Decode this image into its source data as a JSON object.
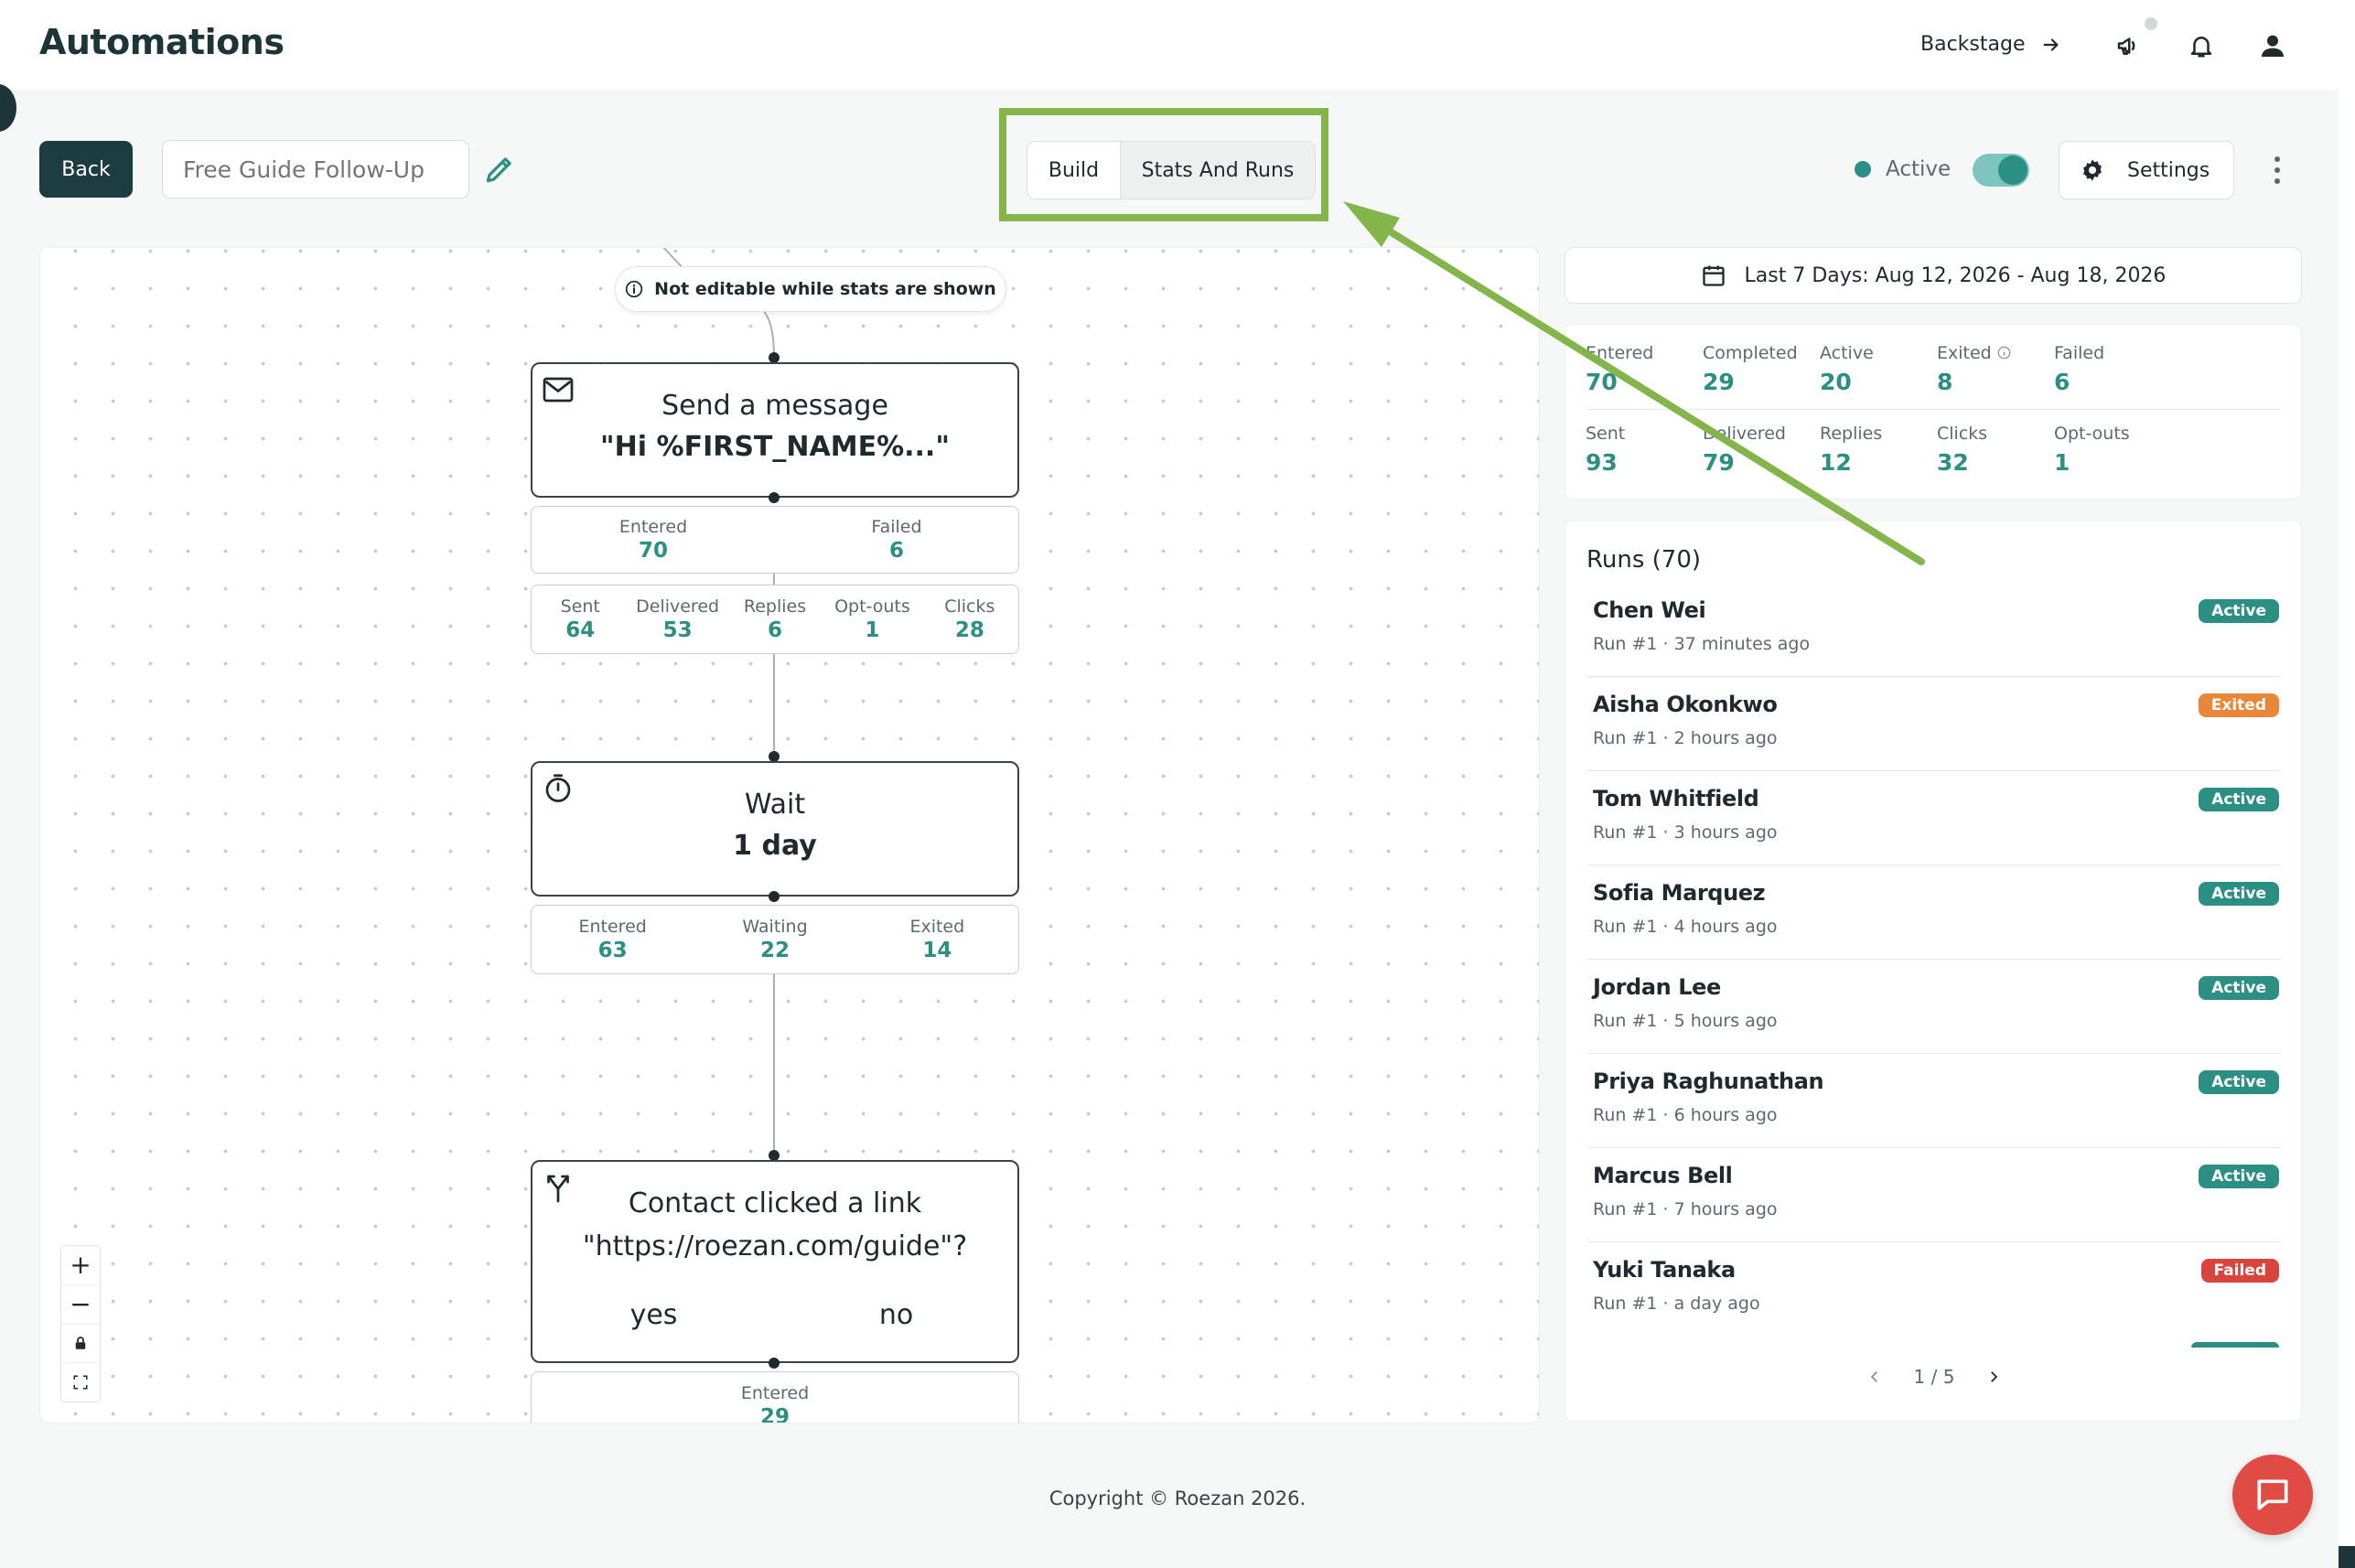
{
  "header": {
    "title": "Automations",
    "backstage_label": "Backstage"
  },
  "toolbar": {
    "back_label": "Back",
    "name_placeholder": "Free Guide Follow-Up",
    "tabs": [
      {
        "label": "Build",
        "selected": false
      },
      {
        "label": "Stats And Runs",
        "selected": true
      }
    ],
    "status_label": "Active",
    "status_on": true,
    "settings_label": "Settings"
  },
  "canvas": {
    "notice": "Not editable while stats are shown",
    "nodes": {
      "send": {
        "title": "Send a message",
        "subtitle": "\"Hi %FIRST_NAME%...\"",
        "stats_top": [
          {
            "label": "Entered",
            "value": "70"
          },
          {
            "label": "Failed",
            "value": "6"
          }
        ],
        "stats_bottom": [
          {
            "label": "Sent",
            "value": "64"
          },
          {
            "label": "Delivered",
            "value": "53"
          },
          {
            "label": "Replies",
            "value": "6"
          },
          {
            "label": "Opt-outs",
            "value": "1"
          },
          {
            "label": "Clicks",
            "value": "28"
          }
        ]
      },
      "wait": {
        "title": "Wait",
        "subtitle": "1 day",
        "stats": [
          {
            "label": "Entered",
            "value": "63"
          },
          {
            "label": "Waiting",
            "value": "22"
          },
          {
            "label": "Exited",
            "value": "14"
          }
        ]
      },
      "condition": {
        "title": "Contact clicked a link",
        "subtitle": "\"https://roezan.com/guide\"?",
        "yes_label": "yes",
        "no_label": "no",
        "stats": [
          {
            "label": "Entered",
            "value": "29"
          }
        ]
      }
    },
    "zoom_controls": {
      "zoom_in": "+",
      "zoom_out": "−"
    }
  },
  "sidebar": {
    "date_range": "Last 7 Days: Aug 12, 2026 - Aug 18, 2026",
    "stats_row1": [
      {
        "label": "Entered",
        "value": "70"
      },
      {
        "label": "Completed",
        "value": "29"
      },
      {
        "label": "Active",
        "value": "20"
      },
      {
        "label": "Exited",
        "value": "8"
      },
      {
        "label": "Failed",
        "value": "6"
      }
    ],
    "stats_row2": [
      {
        "label": "Sent",
        "value": "93"
      },
      {
        "label": "Delivered",
        "value": "79"
      },
      {
        "label": "Replies",
        "value": "12"
      },
      {
        "label": "Clicks",
        "value": "32"
      },
      {
        "label": "Opt-outs",
        "value": "1"
      }
    ],
    "runs_title": "Runs (70)",
    "runs": [
      {
        "name": "Chen Wei",
        "meta": "Run #1 · 37 minutes ago",
        "status": "Active",
        "color": "#2c8f84"
      },
      {
        "name": "Aisha Okonkwo",
        "meta": "Run #1 · 2 hours ago",
        "status": "Exited",
        "color": "#e8873a"
      },
      {
        "name": "Tom Whitfield",
        "meta": "Run #1 · 3 hours ago",
        "status": "Active",
        "color": "#2c8f84"
      },
      {
        "name": "Sofia Marquez",
        "meta": "Run #1 · 4 hours ago",
        "status": "Active",
        "color": "#2c8f84"
      },
      {
        "name": "Jordan Lee",
        "meta": "Run #1 · 5 hours ago",
        "status": "Active",
        "color": "#2c8f84"
      },
      {
        "name": "Priya Raghunathan",
        "meta": "Run #1 · 6 hours ago",
        "status": "Active",
        "color": "#2c8f84"
      },
      {
        "name": "Marcus Bell",
        "meta": "Run #1 · 7 hours ago",
        "status": "Active",
        "color": "#2c8f84"
      },
      {
        "name": "Yuki Tanaka",
        "meta": "Run #1 · a day ago",
        "status": "Failed",
        "color": "#d9443c"
      }
    ],
    "pager": "1 / 5"
  },
  "footer": {
    "copyright": "Copyright © Roezan 2026."
  },
  "colors": {
    "accent": "#2c8f84",
    "dark": "#1d3c41",
    "highlight": "#83b54b",
    "chat": "#e04b43"
  }
}
